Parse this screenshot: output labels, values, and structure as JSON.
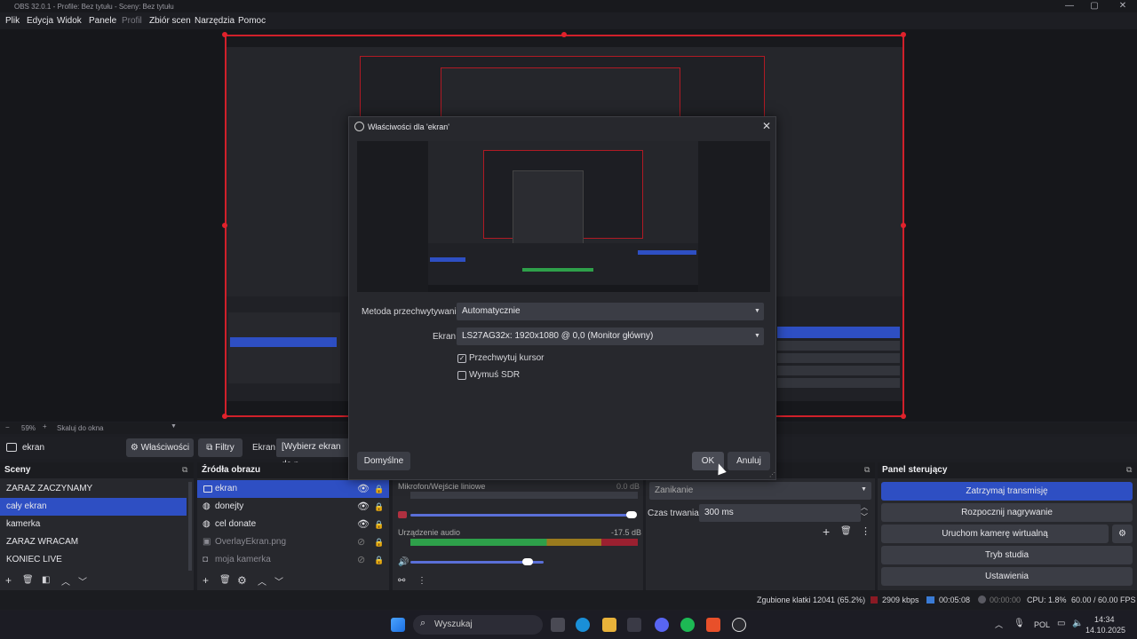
{
  "window": {
    "title": "OBS 32.0.1 - Profile: Bez tytułu - Sceny: Bez tytułu",
    "minimize": "—",
    "maximize": "▢",
    "close": "✕"
  },
  "menu": [
    "Plik",
    "Edycja",
    "Widok",
    "Panele",
    "Profil",
    "Zbiór scen",
    "Narzędzia",
    "Pomoc"
  ],
  "preview": {
    "zoom": "59%",
    "scale_mode": "Skaluj do okna"
  },
  "source_bar": {
    "source_name": "ekran",
    "properties_label": "Właściwości",
    "filters_label": "Filtry",
    "screen_label": "Ekran",
    "screen_value": "[Wybierz ekran do p"
  },
  "scenes": {
    "title": "Sceny",
    "items": [
      "ZARAZ ZACZYNAMY",
      "cały ekran",
      "kamerka",
      "ZARAZ WRACAM",
      "KONIEC LIVE"
    ],
    "selected": 1
  },
  "sources": {
    "title": "Źródła obrazu",
    "items": [
      "ekran",
      "donejty",
      "cel donate",
      "OverlayEkran.png",
      "moja kamerka"
    ]
  },
  "mixer": {
    "channels": [
      {
        "name": "Mikrofon/Wejście liniowe",
        "db": "0.0 dB",
        "level": 0.0,
        "volume": 1.0
      },
      {
        "name": "Urządzenie audio",
        "db": "-17.5 dB",
        "level": 0.72,
        "volume": 0.6
      }
    ],
    "scale": [
      "-60",
      "-55",
      "-50",
      "-45",
      "-40",
      "-35",
      "-30",
      "-25",
      "-20",
      "-15",
      "-10",
      "-5",
      "0"
    ]
  },
  "transitions": {
    "type": "Zanikanie",
    "duration_label": "Czas trwania",
    "duration_value": "300 ms"
  },
  "controls": {
    "title": "Panel sterujący",
    "buttons": [
      "Zatrzymaj transmisję",
      "Rozpocznij nagrywanie",
      "Uruchom kamerę wirtualną",
      "Tryb studia",
      "Ustawienia"
    ]
  },
  "status": {
    "dropped": "Zgubione klatki 12041 (65.2%)",
    "bitrate": "2909 kbps",
    "stream_time": "00:05:08",
    "rec_time": "00:00:00",
    "cpu": "CPU: 1.8%",
    "fps": "60.00 / 60.00 FPS"
  },
  "dialog": {
    "title": "Właściwości dla 'ekran'",
    "capture_method_label": "Metoda przechwytywania",
    "capture_method_value": "Automatycznie",
    "screen_label": "Ekran",
    "screen_value": "LS27AG32x: 1920x1080 @ 0,0 (Monitor główny)",
    "capture_cursor_label": "Przechwytuj kursor",
    "force_sdr_label": "Wymuś SDR",
    "defaults_label": "Domyślne",
    "ok_label": "OK",
    "cancel_label": "Anuluj"
  },
  "taskbar": {
    "search_placeholder": "Wyszukaj",
    "lang": "POL",
    "time": "14:34",
    "date": "14.10.2025"
  },
  "colors": {
    "accent": "#2e4fc3",
    "selection_red": "#d0202a"
  }
}
